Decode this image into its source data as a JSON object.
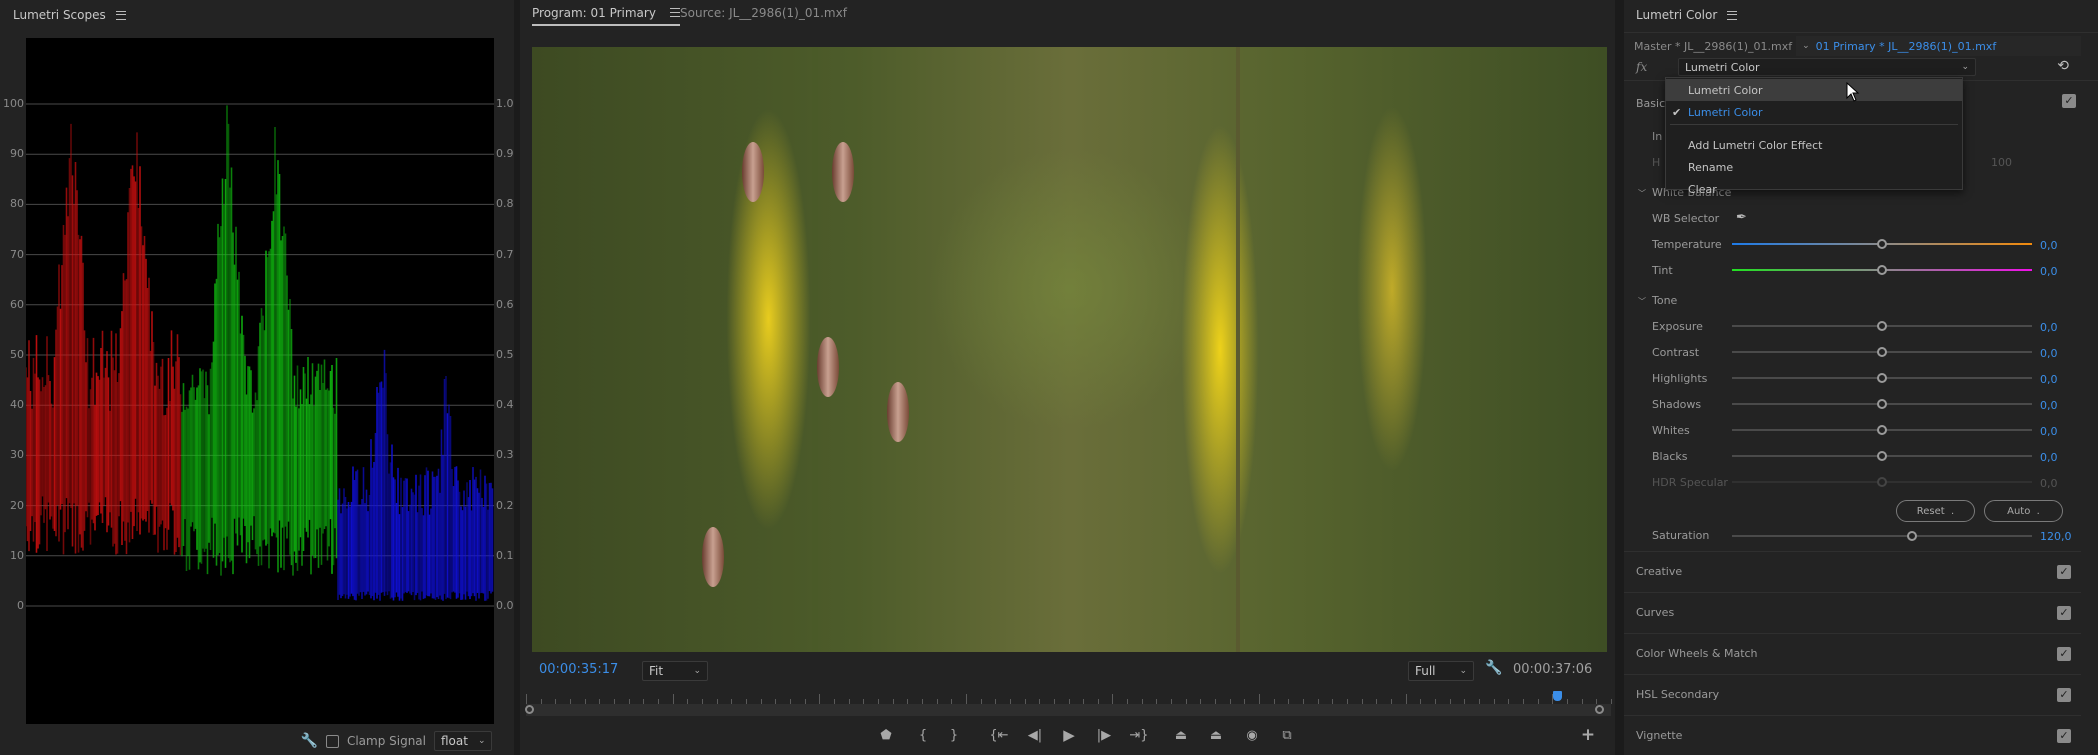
{
  "scopes": {
    "title": "Lumetri Scopes",
    "left_ticks": [
      "100",
      "90",
      "80",
      "70",
      "60",
      "50",
      "40",
      "30",
      "20",
      "10",
      "0"
    ],
    "right_ticks": [
      "1.0",
      "0.9",
      "0.8",
      "0.7",
      "0.6",
      "0.5",
      "0.4",
      "0.3",
      "0.2",
      "0.1",
      "0.0"
    ],
    "scope_type": "RGB Parade",
    "channel_colors": {
      "red": "#d01010",
      "green": "#10c010",
      "blue": "#1010e0"
    },
    "clamp_signal_label": "Clamp Signal",
    "clamp_signal_checked": false,
    "bit_depth": "float"
  },
  "program": {
    "tab_active": "Program: 01 Primary",
    "tab_inactive": "Source: JL__2986(1)_01.mxf",
    "timecode_current": "00:00:35:17",
    "timecode_duration": "00:00:37:06",
    "zoom_select": "Fit",
    "resolution_select": "Full",
    "playhead_position_fraction": 0.95,
    "accent": "#3b8ee8",
    "transport_buttons": [
      {
        "name": "add-marker-button",
        "glyph": "⬟"
      },
      {
        "name": "mark-in-button",
        "glyph": "{"
      },
      {
        "name": "mark-out-button",
        "glyph": "}"
      },
      {
        "name": "go-to-in-button",
        "glyph": "{⇤"
      },
      {
        "name": "step-back-button",
        "glyph": "◀|"
      },
      {
        "name": "play-button",
        "glyph": "▶"
      },
      {
        "name": "step-forward-button",
        "glyph": "|▶"
      },
      {
        "name": "go-to-out-button",
        "glyph": "⇥}"
      },
      {
        "name": "lift-button",
        "glyph": "⏏"
      },
      {
        "name": "extract-button",
        "glyph": "⏏"
      },
      {
        "name": "export-frame-button",
        "glyph": "📷"
      },
      {
        "name": "comparison-view-button",
        "glyph": "⧉"
      }
    ],
    "add_button": "+"
  },
  "lumetri": {
    "title": "Lumetri Color",
    "clip_master": "Master * JL__2986(1)_01.mxf",
    "clip_sequence": "01 Primary * JL__2986(1)_01.mxf",
    "fx_label": "fx",
    "effect_select": "Lumetri Color",
    "basic_section": "Basic",
    "hidden_row_input": "In",
    "hidden_row_hdr": "H",
    "hidden_value": "100",
    "white_balance": {
      "header": "White Balance",
      "wb_selector": "WB Selector",
      "temperature": {
        "label": "Temperature",
        "value": "0,0",
        "position": 0.5
      },
      "tint": {
        "label": "Tint",
        "value": "0,0",
        "position": 0.5
      }
    },
    "tone": {
      "header": "Tone",
      "rows": [
        {
          "label": "Exposure",
          "value": "0,0",
          "position": 0.5
        },
        {
          "label": "Contrast",
          "value": "0,0",
          "position": 0.5
        },
        {
          "label": "Highlights",
          "value": "0,0",
          "position": 0.5
        },
        {
          "label": "Shadows",
          "value": "0,0",
          "position": 0.5
        },
        {
          "label": "Whites",
          "value": "0,0",
          "position": 0.5
        },
        {
          "label": "Blacks",
          "value": "0,0",
          "position": 0.5
        },
        {
          "label": "HDR Specular",
          "value": "0,0",
          "position": 0.5,
          "disabled": true
        }
      ],
      "reset_label": "Reset",
      "auto_label": "Auto"
    },
    "saturation": {
      "label": "Saturation",
      "value": "120,0",
      "position": 0.6
    },
    "sections": [
      {
        "label": "Creative",
        "enabled": true
      },
      {
        "label": "Curves",
        "enabled": true
      },
      {
        "label": "Color Wheels & Match",
        "enabled": true
      },
      {
        "label": "HSL Secondary",
        "enabled": true
      },
      {
        "label": "Vignette",
        "enabled": true
      }
    ],
    "dropdown": {
      "items": [
        {
          "label": "Lumetri Color",
          "state": "hover"
        },
        {
          "label": "Lumetri Color",
          "state": "selected"
        },
        {
          "label": "Add Lumetri Color Effect"
        },
        {
          "label": "Rename"
        },
        {
          "label": "Clear"
        }
      ]
    }
  }
}
